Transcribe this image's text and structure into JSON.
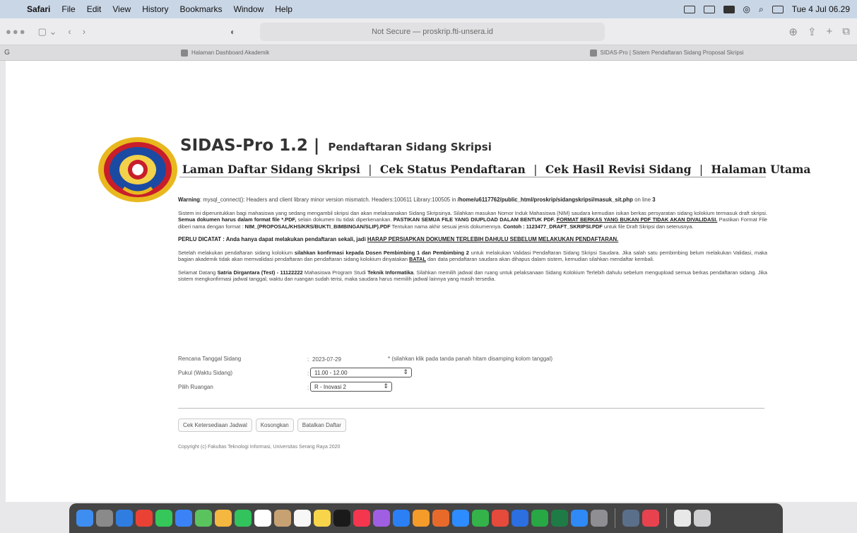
{
  "menubar": {
    "app": "Safari",
    "items": [
      "File",
      "Edit",
      "View",
      "History",
      "Bookmarks",
      "Window",
      "Help"
    ],
    "clock": "Tue 4 Jul 06.29"
  },
  "toolbar": {
    "url": "Not Secure — proskrip.fti-unsera.id",
    "shield": "◐"
  },
  "tabs": [
    {
      "label": "Halaman Dashboard Akademik"
    },
    {
      "label": "SIDAS-Pro | Sistem Pendaftaran Sidang Proposal Skripsi"
    }
  ],
  "page": {
    "title": "SIDAS-Pro 1.2",
    "title_sep": "|",
    "subtitle": "Pendaftaran Sidang Skripsi",
    "nav": [
      "Laman Daftar Sidang Skripsi",
      "Cek Status Pendaftaran",
      "Cek Hasil Revisi Sidang",
      "Halaman Utama"
    ],
    "nav_sep": "|",
    "warning_label": "Warning",
    "warning_text": ": mysql_connect(): Headers and client library minor version mismatch. Headers:100611 Library:100505 in ",
    "warning_path": "/home/u6117762/public_html/proskrip/sidangskripsi/masuk_sit.php",
    "warning_on": " on line ",
    "warning_line": "3",
    "p1_a": "Sistem ini diperuntukkan bagi mahasiswa yang sedang mengambil skripsi dan akan melaksanakan Sidang Skripsinya. Silahkan masukan Nomor Induk Mahasiswa (NIM) saudara kemudian isikan berkas persyaratan sidang kolokium termasuk draft skripsi. ",
    "p1_b": "Semua dokumen harus dalam format file *.PDF,",
    "p1_c": " selain dokumen itu tidak diperkenankan. ",
    "p1_d": "PASTIKAN SEMUA FILE YANG DIUPLOAD DALAM BENTUK PDF.",
    "p1_e": "FORMAT BERKAS YANG BUKAN PDF TIDAK AKAN DIVALIDASI.",
    "p1_f": " Pastikan Format File diberi nama dengan format : ",
    "p1_g": "NIM_(PROPOSAL/KHS/KRS/BUKTI_BIMBINGAN/SLIP).PDF",
    "p1_h": " Tentukan nama akhir sesuai jenis dokumennya. ",
    "p1_i": "Contoh : 1123477_DRAFT_SKRIPSI.PDF",
    "p1_j": " untuk file Draft Skripsi dan seterusnya.",
    "p2_a": "PERLU DICATAT : Anda hanya dapat melakukan pendaftaran sekali, jadi ",
    "p2_b": "HARAP PERSIAPKAN DOKUMEN TERLEBIH DAHULU SEBELUM MELAKUKAN PENDAFTARAN.",
    "p3_a": "Setelah melakukan pendaftaran sidang kolokium ",
    "p3_b": "silahkan konfirmasi kepada Dosen Pembimbing 1 dan Pembimbing 2",
    "p3_c": " untuk melakukan Validasi Pendaftaran Sidang Skripsi Saudara. Jika salah satu pembimbing belum melakukan Validasi, maka bagian akademik tidak akan memvalidasi pendaftaran dan pendaftaran sidang kolokium dinyatakan ",
    "p3_d": "BATAL",
    "p3_e": " dan data pendaftaran saudara akan dihapus dalam sistem, kemudian silahkan mendaftar kembali.",
    "p4_a": "Selamat Datang ",
    "p4_b": "Satria Dirgantara (Test) - 11122222",
    "p4_c": " Mahasiswa Program Studi ",
    "p4_d": "Teknik Informatika",
    "p4_e": ". Silahkan memilih jadwal dan ruang untuk pelaksanaan Sidang Kolokium Terlebih dahulu sebelum mengupload semua berkas pendaftaran sidang. Jika sistem mengkonfirmasi jadwal tanggal, waktu dan ruangan sudah terisi, maka saudara harus memilih jadwal lainnya yang masih tersedia."
  },
  "form": {
    "date_label": "Rencana Tanggal Sidang",
    "date_value": "2023-07-29",
    "date_hint": "* (silahkan klik pada tanda panah hitam disamping kolom tanggal)",
    "time_label": "Pukul (Waktu Sidang)",
    "time_value": "11.00 - 12.00",
    "room_label": "Pilih Ruangan",
    "room_value": "R - Inovasi 2",
    "colon": ":"
  },
  "buttons": {
    "check": "Cek Ketersediaan Jadwal",
    "clear": "Kosongkan",
    "cancel": "Batalkan Daftar"
  },
  "footer": {
    "copyright": "Copyright (c) Fakultas Teknologi Informasi, Universitas Serang Raya 2020"
  },
  "colors": {
    "menubar": "#c9d6e6",
    "logo_outer": "#e8b81e",
    "logo_inner": "#1b4aa3",
    "logo_red": "#c81e2b"
  }
}
